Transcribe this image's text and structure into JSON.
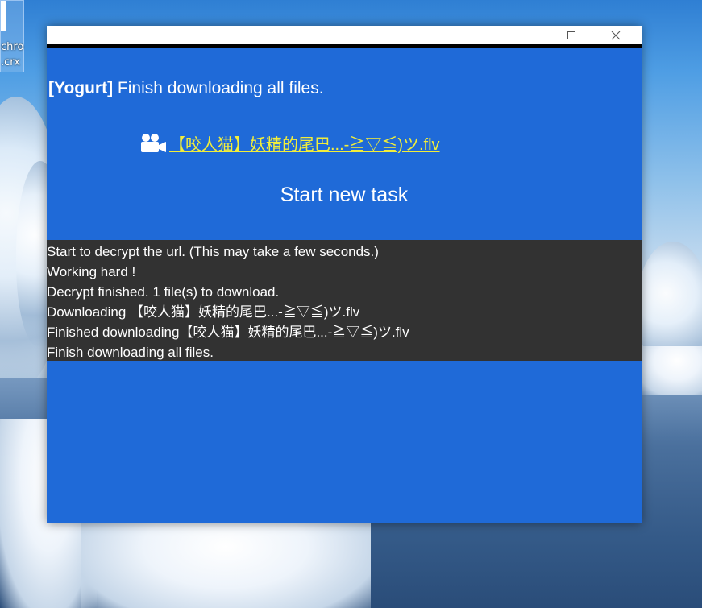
{
  "desktop": {
    "icon": {
      "label_line1": "chro",
      "label_line2": ".crx"
    }
  },
  "window": {
    "controls": {
      "minimize": "minimize",
      "maximize": "maximize",
      "close": "close"
    },
    "headline": {
      "app_name": "[Yogurt]",
      "message": " Finish downloading all files."
    },
    "file": {
      "icon": "video-camera-icon",
      "name": "【咬人猫】妖精的尾巴...-≧▽≦)ツ.flv"
    },
    "start_task_label": "Start new task",
    "log": [
      "Start to decrypt the url. (This may take a few seconds.)",
      "Working hard !",
      "Decrypt finished. 1 file(s) to download.",
      "Downloading 【咬人猫】妖精的尾巴...-≧▽≦)ツ.flv",
      "Finished downloading【咬人猫】妖精的尾巴...-≧▽≦)ツ.flv",
      "Finish downloading all files."
    ]
  },
  "colors": {
    "window_bg": "#1f6ad8",
    "log_bg": "#323232",
    "link": "#f2ee3a",
    "text": "#ffffff"
  }
}
